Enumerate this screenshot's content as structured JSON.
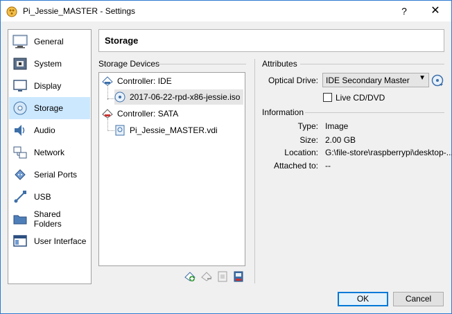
{
  "window": {
    "title": "Pi_Jessie_MASTER - Settings",
    "help_glyph": "?",
    "close_glyph": "✕"
  },
  "sidebar": {
    "items": [
      {
        "label": "General",
        "icon": "general-icon"
      },
      {
        "label": "System",
        "icon": "system-icon"
      },
      {
        "label": "Display",
        "icon": "display-icon"
      },
      {
        "label": "Storage",
        "icon": "storage-icon",
        "selected": true
      },
      {
        "label": "Audio",
        "icon": "audio-icon"
      },
      {
        "label": "Network",
        "icon": "network-icon"
      },
      {
        "label": "Serial Ports",
        "icon": "serial-ports-icon"
      },
      {
        "label": "USB",
        "icon": "usb-icon"
      },
      {
        "label": "Shared Folders",
        "icon": "shared-folders-icon"
      },
      {
        "label": "User Interface",
        "icon": "user-interface-icon"
      }
    ]
  },
  "header": {
    "title": "Storage"
  },
  "storage_devices": {
    "title": "Storage Devices",
    "controllers": [
      {
        "label": "Controller: IDE",
        "children": [
          {
            "label": "2017-06-22-rpd-x86-jessie.iso",
            "type": "optical",
            "selected": true
          }
        ]
      },
      {
        "label": "Controller: SATA",
        "children": [
          {
            "label": "Pi_Jessie_MASTER.vdi",
            "type": "disk"
          }
        ]
      }
    ]
  },
  "attributes": {
    "title": "Attributes",
    "optical_drive_label": "Optical Drive:",
    "optical_drive_value": "IDE Secondary Master",
    "live_cd_label": "Live CD/DVD",
    "live_cd_checked": false
  },
  "information": {
    "title": "Information",
    "rows": [
      {
        "label": "Type:",
        "value": "Image"
      },
      {
        "label": "Size:",
        "value": "2.00 GB"
      },
      {
        "label": "Location:",
        "value": "G:\\file-store\\raspberrypi\\desktop-..."
      },
      {
        "label": "Attached to:",
        "value": "--"
      }
    ]
  },
  "buttons": {
    "ok": "OK",
    "cancel": "Cancel"
  },
  "colors": {
    "accent": "#0078d7",
    "selection": "#cce8ff"
  }
}
